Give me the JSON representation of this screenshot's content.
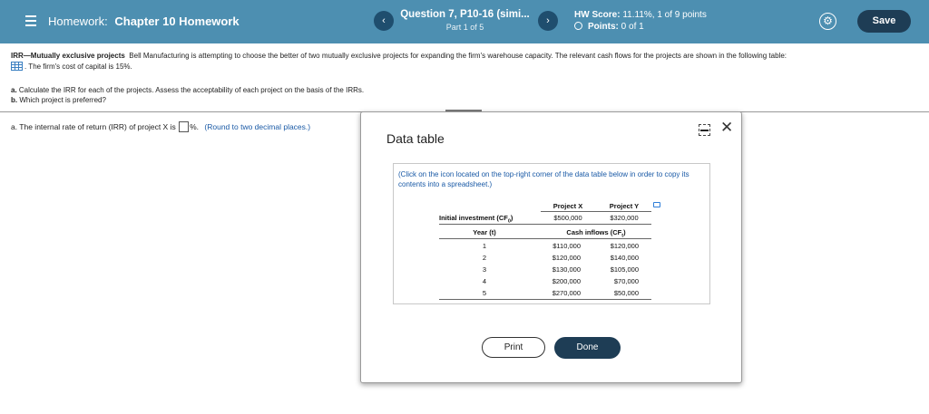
{
  "header": {
    "homework_label": "Homework:",
    "chapter": "Chapter 10 Homework",
    "question_title": "Question 7, P10-16 (simi...",
    "question_part": "Part 1 of 5",
    "prev": "‹",
    "next": "›",
    "hw_score_label": "HW Score:",
    "hw_score_value": "11.11%, 1 of 9 points",
    "points_label": "Points:",
    "points_value": "0 of 1",
    "save_label": "Save",
    "icons": [
      "menu-icon",
      "gear-icon"
    ]
  },
  "question": {
    "title": "IRR—Mutually exclusive projects",
    "body": "Bell Manufacturing is attempting to choose the better of two mutually exclusive projects for expanding the firm's warehouse capacity.  The relevant cash flows for the projects are shown in the following table:",
    "cost_of_capital": ". The firm's cost of capital is 15%.",
    "part_a_prefix": "a.",
    "part_a": "Calculate the IRR for each of the projects.  Assess the acceptability of each project on the basis of the IRRs.",
    "part_b_prefix": "b.",
    "part_b": "Which project is preferred?",
    "answer_prefix": "a.  The internal rate of return (IRR) of project X is",
    "answer_suffix": "%.",
    "answer_hint": "(Round to two decimal places.)"
  },
  "modal": {
    "title": "Data table",
    "note": "(Click on the icon located on the top-right corner of the data table below in order to copy its contents into a spreadsheet.)",
    "col_x": "Project X",
    "col_y": "Project Y",
    "initial_label": "Initial investment (CF",
    "initial_sub": "0",
    "initial_x": "$500,000",
    "initial_y": "$320,000",
    "year_label": "Year (t)",
    "inflows_label": "Cash inflows (CF",
    "inflows_sub": "t",
    "rows": [
      {
        "year": "1",
        "x": "$110,000",
        "y": "$120,000"
      },
      {
        "year": "2",
        "x": "$120,000",
        "y": "$140,000"
      },
      {
        "year": "3",
        "x": "$130,000",
        "y": "$105,000"
      },
      {
        "year": "4",
        "x": "$200,000",
        "y": "$70,000"
      },
      {
        "year": "5",
        "x": "$270,000",
        "y": "$50,000"
      }
    ],
    "print_label": "Print",
    "done_label": "Done",
    "close": "✕"
  }
}
